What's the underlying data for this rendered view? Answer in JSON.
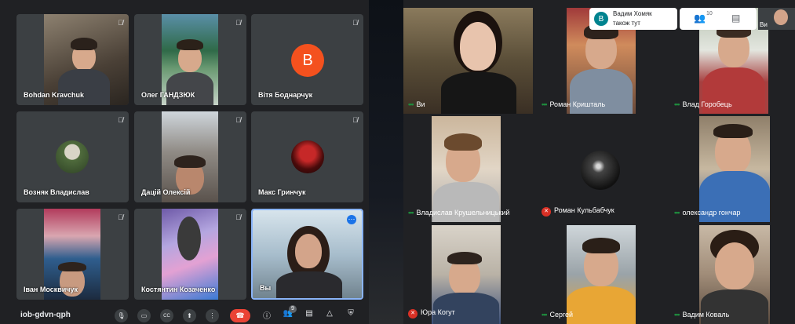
{
  "left_tiles": [
    {
      "name": "Bohdan Kravchuk"
    },
    {
      "name": "Олег ГАНДЗЮК"
    },
    {
      "name": "Вітя Боднарчук",
      "avatar_letter": "B",
      "avatar_color": "#f4511e"
    },
    {
      "name": "Возняк Владислав"
    },
    {
      "name": "Дацій Олексій"
    },
    {
      "name": "Макс Гринчук"
    },
    {
      "name": "Іван Москвичук"
    },
    {
      "name": "Костянтин Козаченко"
    },
    {
      "name": "Вы"
    }
  ],
  "meeting_code": "iob-gdvn-qph",
  "participant_badge": "9",
  "controls": [
    "mic-icon",
    "camera-icon",
    "captions-icon",
    "present-icon",
    "more-icon",
    "end-call-icon",
    "info-icon",
    "people-icon",
    "chat-icon",
    "activities-icon",
    "security-icon"
  ],
  "right_tiles": [
    {
      "name": "Ви",
      "status": "speaking"
    },
    {
      "name": "Роман Кришталь",
      "status": "speaking"
    },
    {
      "name": "Влад Горобець",
      "status": "speaking"
    },
    {
      "name": "Владислав Крушельницький",
      "status": "speaking"
    },
    {
      "name": "Роман Кульбабчук",
      "status": "muted"
    },
    {
      "name": "олександр гончар",
      "status": "speaking"
    },
    {
      "name": "Юра Когут",
      "status": "muted"
    },
    {
      "name": "Сергей",
      "status": "speaking"
    },
    {
      "name": "Вадим Коваль",
      "status": "speaking"
    }
  ],
  "notification": {
    "avatar_letter": "B",
    "line1": "Вадим Хомяк",
    "line2": "також тут"
  },
  "people_count": "10",
  "corner_label": "Ви",
  "colors": {
    "speaking": "#1e8e3e",
    "muted": "#d93025",
    "end_call": "#ea4335",
    "tile_bg": "#3c4043",
    "page_bg": "#202124"
  }
}
